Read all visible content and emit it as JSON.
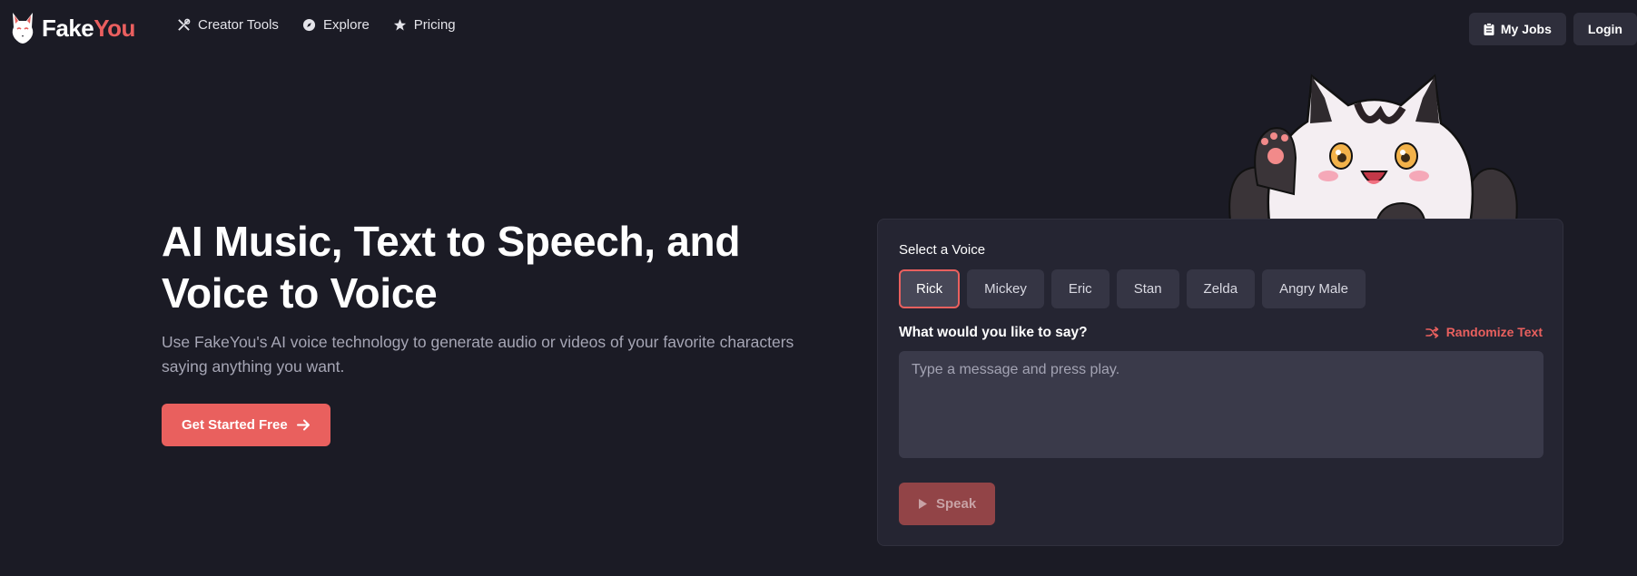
{
  "brand": {
    "name_part1": "Fake",
    "name_part2": "You"
  },
  "nav": {
    "items": [
      {
        "label": "Creator Tools",
        "icon": "tools-icon"
      },
      {
        "label": "Explore",
        "icon": "compass-icon"
      },
      {
        "label": "Pricing",
        "icon": "star-icon"
      }
    ]
  },
  "top_actions": {
    "my_jobs": "My Jobs",
    "login": "Login"
  },
  "hero": {
    "title_line1": "AI Music, Text to Speech, and",
    "title_line2": "Voice to Voice",
    "subtitle": "Use FakeYou's AI voice technology to generate audio or videos of your favorite characters saying anything you want.",
    "cta": "Get Started Free"
  },
  "voice_panel": {
    "select_label": "Select a Voice",
    "voices": [
      "Rick",
      "Mickey",
      "Eric",
      "Stan",
      "Zelda",
      "Angry Male"
    ],
    "selected_voice": "Rick",
    "prompt_label": "What would you like to say?",
    "randomize_label": "Randomize Text",
    "textarea_value": "",
    "textarea_placeholder": "Type a message and press play.",
    "speak_label": "Speak"
  },
  "colors": {
    "background": "#1b1b25",
    "accent": "#e9605e",
    "panel": "#252532",
    "chip": "#353544"
  }
}
